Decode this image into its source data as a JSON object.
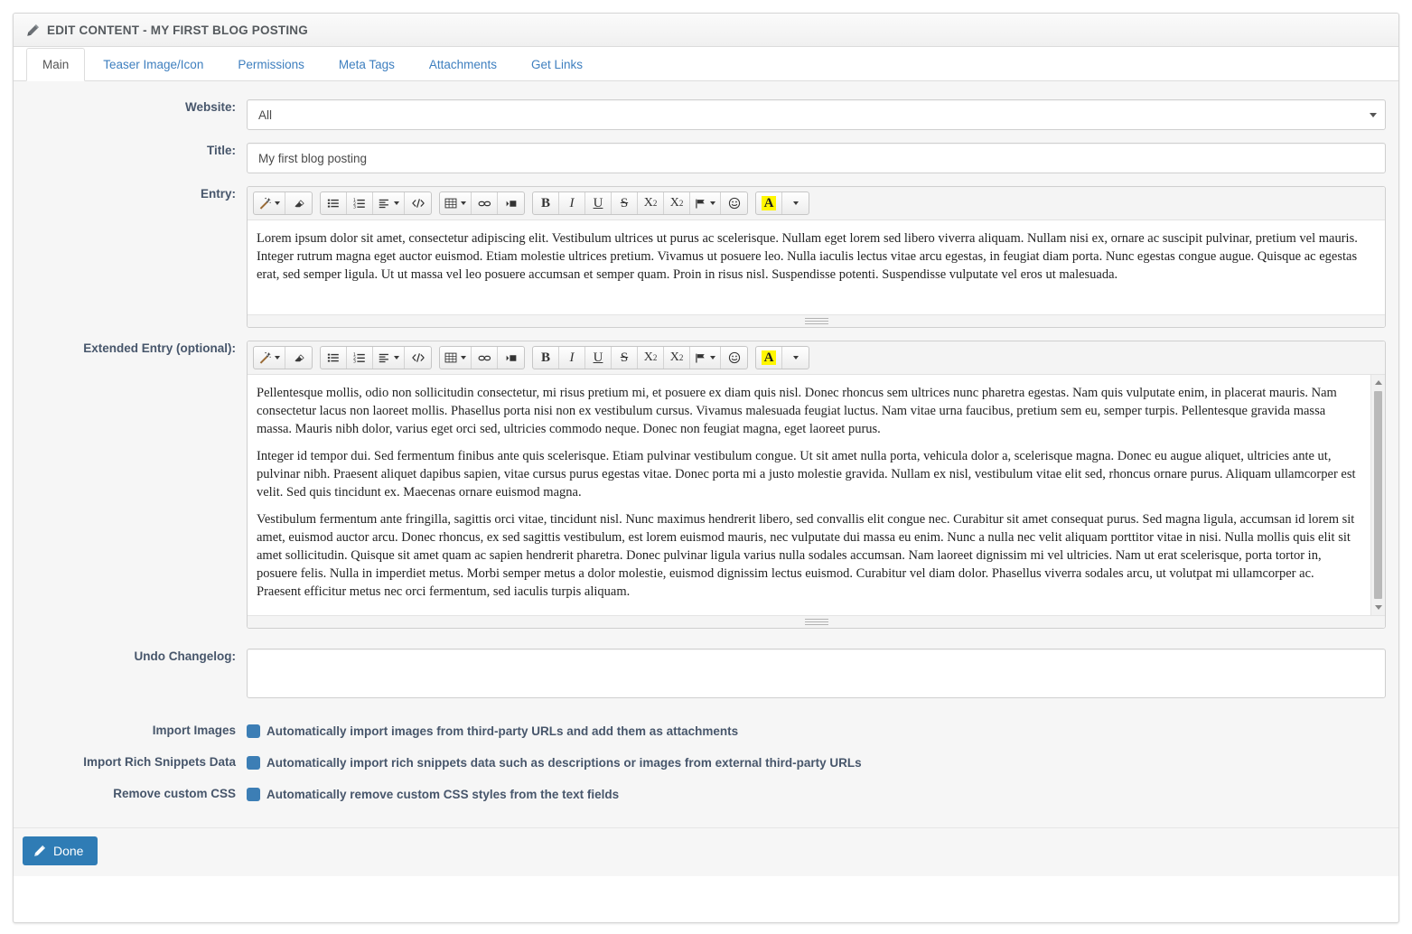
{
  "header": {
    "icon": "pencil-icon",
    "title": "EDIT CONTENT - MY FIRST BLOG POSTING"
  },
  "tabs": [
    {
      "label": "Main",
      "active": true
    },
    {
      "label": "Teaser Image/Icon",
      "active": false
    },
    {
      "label": "Permissions",
      "active": false
    },
    {
      "label": "Meta Tags",
      "active": false
    },
    {
      "label": "Attachments",
      "active": false
    },
    {
      "label": "Get Links",
      "active": false
    }
  ],
  "form": {
    "website": {
      "label": "Website:",
      "value": "All"
    },
    "title": {
      "label": "Title:",
      "value": "My first blog posting",
      "placeholder": ""
    },
    "entry": {
      "label": "Entry:"
    },
    "extended_entry": {
      "label": "Extended Entry (optional):"
    },
    "undo_changelog": {
      "label": "Undo Changelog:",
      "value": "",
      "placeholder": ""
    }
  },
  "toolbar": {
    "groups": [
      [
        {
          "name": "magic-wand-icon",
          "glyph": "wand",
          "dropdown": true
        },
        {
          "name": "eraser-icon",
          "glyph": "eraser",
          "dropdown": false
        }
      ],
      [
        {
          "name": "unordered-list-icon",
          "glyph": "ul",
          "dropdown": false
        },
        {
          "name": "ordered-list-icon",
          "glyph": "ol",
          "dropdown": false
        },
        {
          "name": "align-icon",
          "glyph": "align",
          "dropdown": true
        },
        {
          "name": "source-code-icon",
          "glyph": "code",
          "dropdown": false
        }
      ],
      [
        {
          "name": "table-icon",
          "glyph": "table",
          "dropdown": true
        },
        {
          "name": "link-icon",
          "glyph": "link",
          "dropdown": false
        },
        {
          "name": "insert-media-icon",
          "glyph": "media",
          "dropdown": false
        }
      ],
      [
        {
          "name": "bold-icon",
          "glyph": "B",
          "dropdown": false
        },
        {
          "name": "italic-icon",
          "glyph": "I",
          "dropdown": false
        },
        {
          "name": "underline-icon",
          "glyph": "U",
          "dropdown": false
        },
        {
          "name": "strikethrough-icon",
          "glyph": "S",
          "dropdown": false
        },
        {
          "name": "superscript-icon",
          "glyph": "X2sup",
          "dropdown": false
        },
        {
          "name": "subscript-icon",
          "glyph": "X2sub",
          "dropdown": false
        },
        {
          "name": "flag-icon",
          "glyph": "flag",
          "dropdown": true
        },
        {
          "name": "emoticon-icon",
          "glyph": "smiley",
          "dropdown": false
        }
      ],
      [
        {
          "name": "text-highlight-icon",
          "glyph": "A",
          "dropdown": false
        },
        {
          "name": "text-highlight-dropdown-icon",
          "glyph": "caret",
          "dropdown": true
        }
      ]
    ]
  },
  "entry_content": {
    "paragraphs": [
      "Lorem ipsum dolor sit amet, consectetur adipiscing elit. Vestibulum ultrices ut purus ac scelerisque. Nullam eget lorem sed libero viverra aliquam. Nullam nisi ex, ornare ac suscipit pulvinar, pretium vel mauris. Integer rutrum magna eget auctor euismod. Etiam molestie ultrices pretium. Vivamus ut posuere leo. Nulla iaculis lectus vitae arcu egestas, in feugiat diam porta. Nunc egestas congue augue. Quisque ac egestas erat, sed semper ligula. Ut ut massa vel leo posuere accumsan et semper quam. Proin in risus nisl. Suspendisse potenti. Suspendisse vulputate vel eros ut malesuada."
    ]
  },
  "extended_content": {
    "paragraphs": [
      "Pellentesque mollis, odio non sollicitudin consectetur, mi risus pretium mi, et posuere ex diam quis nisl. Donec rhoncus sem ultrices nunc pharetra egestas. Nam quis vulputate enim, in placerat mauris. Nam consectetur lacus non laoreet mollis. Phasellus porta nisi non ex vestibulum cursus. Vivamus malesuada feugiat luctus. Nam vitae urna faucibus, pretium sem eu, semper turpis. Pellentesque gravida massa massa. Mauris nibh dolor, varius eget orci sed, ultricies commodo neque. Donec non feugiat magna, eget laoreet purus.",
      "Integer id tempor dui. Sed fermentum finibus ante quis scelerisque. Etiam pulvinar vestibulum congue. Ut sit amet nulla porta, vehicula dolor a, scelerisque magna. Donec eu augue aliquet, ultricies ante ut, pulvinar nibh. Praesent aliquet dapibus sapien, vitae cursus purus egestas vitae. Donec porta mi a justo molestie gravida. Nullam ex nisl, vestibulum vitae elit sed, rhoncus ornare purus. Aliquam ullamcorper est velit. Sed quis tincidunt ex. Maecenas ornare euismod magna.",
      "Vestibulum fermentum ante fringilla, sagittis orci vitae, tincidunt nisl. Nunc maximus hendrerit libero, sed convallis elit congue nec. Curabitur sit amet consequat purus. Sed magna ligula, accumsan id lorem sit amet, euismod auctor arcu. Donec rhoncus, ex sed sagittis vestibulum, est lorem euismod mauris, nec vulputate dui massa eu enim. Nunc a nulla nec velit aliquam porttitor vitae in nisi. Nulla mollis quis elit sit amet sollicitudin. Quisque sit amet quam ac sapien hendrerit pharetra. Donec pulvinar ligula varius nulla sodales accumsan. Nam laoreet dignissim mi vel ultricies. Nam ut erat scelerisque, porta tortor in, posuere felis. Nulla in imperdiet metus. Morbi semper metus a dolor molestie, euismod dignissim lectus euismod. Curabitur vel diam dolor. Phasellus viverra sodales arcu, ut volutpat mi ullamcorper ac. Praesent efficitur metus nec orci fermentum, sed iaculis turpis aliquam."
    ]
  },
  "checkboxes": [
    {
      "label": "Import Images",
      "text": "Automatically import images from third-party URLs and add them as attachments",
      "checked": true
    },
    {
      "label": "Import Rich Snippets Data",
      "text": "Automatically import rich snippets data such as descriptions or images from external third-party URLs",
      "checked": true
    },
    {
      "label": "Remove custom CSS",
      "text": "Automatically remove custom CSS styles from the text fields",
      "checked": true
    }
  ],
  "footer": {
    "done_label": "Done",
    "done_icon": "pencil-icon"
  },
  "colors": {
    "accent": "#2f7cb5",
    "label": "#47566b",
    "link": "#3e7fbf",
    "highlight": "#fff600"
  }
}
